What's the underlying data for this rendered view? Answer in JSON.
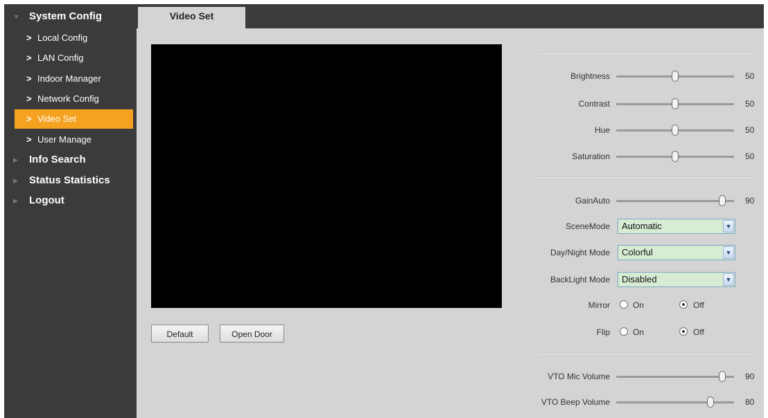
{
  "sidebar": {
    "system_config": "System Config",
    "items": [
      {
        "label": "Local Config"
      },
      {
        "label": "LAN Config"
      },
      {
        "label": "Indoor Manager"
      },
      {
        "label": "Network Config"
      },
      {
        "label": "Video Set"
      },
      {
        "label": "User Manage"
      }
    ],
    "info_search": "Info Search",
    "status_statistics": "Status Statistics",
    "logout": "Logout",
    "active_color": "#f4a21f"
  },
  "tab": {
    "label": "Video Set"
  },
  "buttons": {
    "default": "Default",
    "open_door": "Open Door"
  },
  "image": {
    "brightness": {
      "label": "Brightness",
      "value": "50"
    },
    "contrast": {
      "label": "Contrast",
      "value": "50"
    },
    "hue": {
      "label": "Hue",
      "value": "50"
    },
    "saturation": {
      "label": "Saturation",
      "value": "50"
    }
  },
  "gain": {
    "label": "GainAuto",
    "value": "90"
  },
  "scene": {
    "label": "SceneMode",
    "value": "Automatic"
  },
  "daynight": {
    "label": "Day/Night Mode",
    "value": "Colorful"
  },
  "backlight": {
    "label": "BackLight Mode",
    "value": "Disabled"
  },
  "mirror": {
    "label": "Mirror",
    "on": "On",
    "off": "Off",
    "selected": "Off"
  },
  "flip": {
    "label": "Flip",
    "on": "On",
    "off": "Off",
    "selected": "Off"
  },
  "volume": {
    "mic": {
      "label": "VTO Mic Volume",
      "value": "90"
    },
    "beep": {
      "label": "VTO Beep Volume",
      "value": "80"
    }
  }
}
